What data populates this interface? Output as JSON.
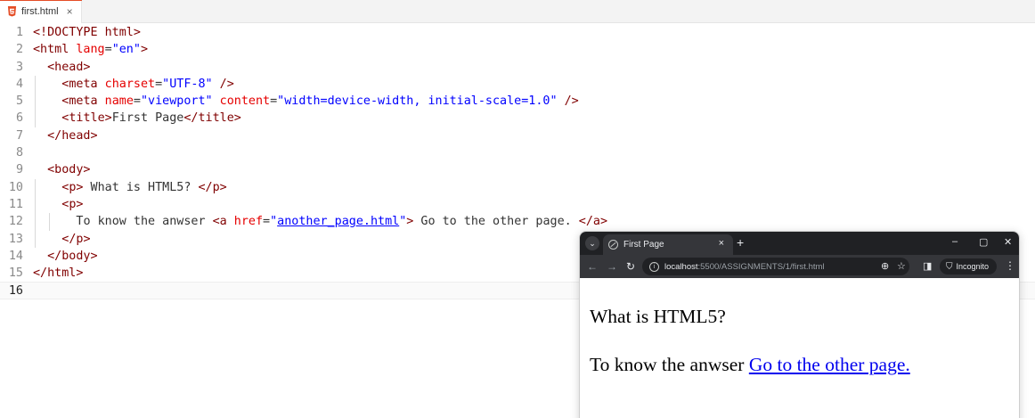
{
  "editor": {
    "tab": {
      "filename": "first.html",
      "close": "×"
    },
    "lines": [
      {
        "n": "1",
        "indent": 0,
        "guides": [],
        "tokens": [
          {
            "t": "tag",
            "v": "<!DOCTYPE html>"
          }
        ]
      },
      {
        "n": "2",
        "indent": 0,
        "guides": [],
        "tokens": [
          {
            "t": "tag",
            "v": "<html"
          },
          {
            "t": "plain",
            "v": " "
          },
          {
            "t": "attr",
            "v": "lang"
          },
          {
            "t": "plain",
            "v": "="
          },
          {
            "t": "val",
            "v": "\"en\""
          },
          {
            "t": "tag",
            "v": ">"
          }
        ]
      },
      {
        "n": "3",
        "indent": 2,
        "guides": [],
        "tokens": [
          {
            "t": "tag",
            "v": "<head>"
          }
        ]
      },
      {
        "n": "4",
        "indent": 4,
        "guides": [
          1
        ],
        "tokens": [
          {
            "t": "tag",
            "v": "<meta"
          },
          {
            "t": "plain",
            "v": " "
          },
          {
            "t": "attr",
            "v": "charset"
          },
          {
            "t": "plain",
            "v": "="
          },
          {
            "t": "val",
            "v": "\"UTF-8\""
          },
          {
            "t": "plain",
            "v": " "
          },
          {
            "t": "tag",
            "v": "/>"
          }
        ]
      },
      {
        "n": "5",
        "indent": 4,
        "guides": [
          1
        ],
        "tokens": [
          {
            "t": "tag",
            "v": "<meta"
          },
          {
            "t": "plain",
            "v": " "
          },
          {
            "t": "attr",
            "v": "name"
          },
          {
            "t": "plain",
            "v": "="
          },
          {
            "t": "val",
            "v": "\"viewport\""
          },
          {
            "t": "plain",
            "v": " "
          },
          {
            "t": "attr",
            "v": "content"
          },
          {
            "t": "plain",
            "v": "="
          },
          {
            "t": "val",
            "v": "\"width=device-width, initial-scale=1.0\""
          },
          {
            "t": "plain",
            "v": " "
          },
          {
            "t": "tag",
            "v": "/>"
          }
        ]
      },
      {
        "n": "6",
        "indent": 4,
        "guides": [
          1
        ],
        "tokens": [
          {
            "t": "tag",
            "v": "<title>"
          },
          {
            "t": "plain",
            "v": "First Page"
          },
          {
            "t": "tag",
            "v": "</title>"
          }
        ]
      },
      {
        "n": "7",
        "indent": 2,
        "guides": [],
        "tokens": [
          {
            "t": "tag",
            "v": "</head>"
          }
        ]
      },
      {
        "n": "8",
        "indent": 0,
        "guides": [],
        "tokens": []
      },
      {
        "n": "9",
        "indent": 2,
        "guides": [],
        "tokens": [
          {
            "t": "tag",
            "v": "<body>"
          }
        ]
      },
      {
        "n": "10",
        "indent": 4,
        "guides": [
          1
        ],
        "tokens": [
          {
            "t": "tag",
            "v": "<p>"
          },
          {
            "t": "plain",
            "v": " What is HTML5? "
          },
          {
            "t": "tag",
            "v": "</p>"
          }
        ]
      },
      {
        "n": "11",
        "indent": 4,
        "guides": [
          1
        ],
        "tokens": [
          {
            "t": "tag",
            "v": "<p>"
          }
        ]
      },
      {
        "n": "12",
        "indent": 6,
        "guides": [
          1,
          2
        ],
        "tokens": [
          {
            "t": "plain",
            "v": "To know the anwser "
          },
          {
            "t": "tag",
            "v": "<a"
          },
          {
            "t": "plain",
            "v": " "
          },
          {
            "t": "attr",
            "v": "href"
          },
          {
            "t": "plain",
            "v": "="
          },
          {
            "t": "val",
            "v": "\""
          },
          {
            "t": "link",
            "v": "another_page.html"
          },
          {
            "t": "val",
            "v": "\""
          },
          {
            "t": "tag",
            "v": ">"
          },
          {
            "t": "plain",
            "v": " Go to the other page. "
          },
          {
            "t": "tag",
            "v": "</a>"
          }
        ]
      },
      {
        "n": "13",
        "indent": 4,
        "guides": [
          1
        ],
        "tokens": [
          {
            "t": "tag",
            "v": "</p>"
          }
        ]
      },
      {
        "n": "14",
        "indent": 2,
        "guides": [],
        "tokens": [
          {
            "t": "tag",
            "v": "</body>"
          }
        ]
      },
      {
        "n": "15",
        "indent": 0,
        "guides": [],
        "tokens": [
          {
            "t": "tag",
            "v": "</html>"
          }
        ]
      },
      {
        "n": "16",
        "indent": 0,
        "guides": [],
        "tokens": [],
        "current": true
      }
    ]
  },
  "browser": {
    "tab_title": "First Page",
    "tab_close": "×",
    "new_tab": "+",
    "window_controls": {
      "minimize": "–",
      "maximize": "▢",
      "close": "✕"
    },
    "url_host": "localhost",
    "url_path": ":5500/ASSIGNMENTS/1/first.html",
    "incognito_label": "Incognito",
    "page": {
      "p1": "What is HTML5?",
      "p2_text": "To know the anwser",
      "p2_link": "Go to the other page."
    }
  },
  "colors": {
    "tag": "#800000",
    "attribute": "#e50000",
    "value": "#0000ff",
    "browser_chrome": "#202124",
    "link": "#0000ee"
  },
  "icons": [
    "html5-file-icon",
    "close-icon",
    "tab-search-icon",
    "globe-icon",
    "back-icon",
    "forward-icon",
    "reload-icon",
    "site-info-icon",
    "zoom-icon",
    "star-icon",
    "side-panel-icon",
    "incognito-icon",
    "kebab-menu-icon"
  ]
}
